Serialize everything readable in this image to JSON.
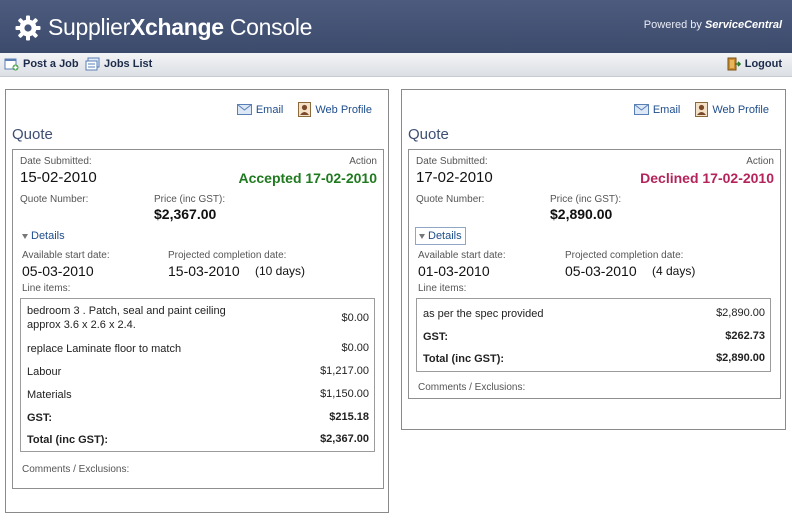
{
  "header": {
    "title_prefix": "Supplier",
    "title_bold": "Xchange",
    "title_suffix": " Console",
    "powered_by": "Powered by",
    "brand": "ServiceCentral"
  },
  "toolbar": {
    "post_job": "Post a Job",
    "jobs_list": "Jobs List",
    "logout": "Logout"
  },
  "quotes": [
    {
      "email_link": "Email",
      "profile_link": "Web Profile",
      "title": "Quote",
      "date_submitted_label": "Date Submitted:",
      "date_submitted": "15-02-2010",
      "action_label": "Action",
      "status": "Accepted 17-02-2010",
      "quote_number_label": "Quote Number:",
      "price_label": "Price (inc GST):",
      "price": "$2,367.00",
      "details_label": "Details",
      "start_label": "Available start date:",
      "start_date": "05-03-2010",
      "completion_label": "Projected completion date:",
      "completion_date": "15-03-2010",
      "duration": "(10 days)",
      "line_items_label": "Line items:",
      "line_items": [
        {
          "desc": "bedroom 3 . Patch, seal and paint ceiling approx 3.6 x 2.6 x 2.4.",
          "amount": "$0.00"
        },
        {
          "desc": "replace Laminate floor to match",
          "amount": "$0.00"
        },
        {
          "desc": "Labour",
          "amount": "$1,217.00"
        },
        {
          "desc": "Materials",
          "amount": "$1,150.00"
        },
        {
          "desc": "GST:",
          "amount": "$215.18"
        },
        {
          "desc": "Total (inc GST):",
          "amount": "$2,367.00"
        }
      ],
      "comments_label": "Comments / Exclusions:"
    },
    {
      "email_link": "Email",
      "profile_link": "Web Profile",
      "title": "Quote",
      "date_submitted_label": "Date Submitted:",
      "date_submitted": "17-02-2010",
      "action_label": "Action",
      "status": "Declined 17-02-2010",
      "quote_number_label": "Quote Number:",
      "price_label": "Price (inc GST):",
      "price": "$2,890.00",
      "details_label": "Details",
      "start_label": "Available start date:",
      "start_date": "01-03-2010",
      "completion_label": "Projected completion date:",
      "completion_date": "05-03-2010",
      "duration": "(4 days)",
      "line_items_label": "Line items:",
      "line_items": [
        {
          "desc": "as per the spec provided",
          "amount": "$2,890.00"
        },
        {
          "desc": "GST:",
          "amount": "$262.73"
        },
        {
          "desc": "Total (inc GST):",
          "amount": "$2,890.00"
        }
      ],
      "comments_label": "Comments / Exclusions:"
    }
  ],
  "colors": {
    "header_bg": "#46547a",
    "accepted": "#1f7a1f",
    "declined": "#b4245a",
    "link": "#1e4d8c"
  }
}
